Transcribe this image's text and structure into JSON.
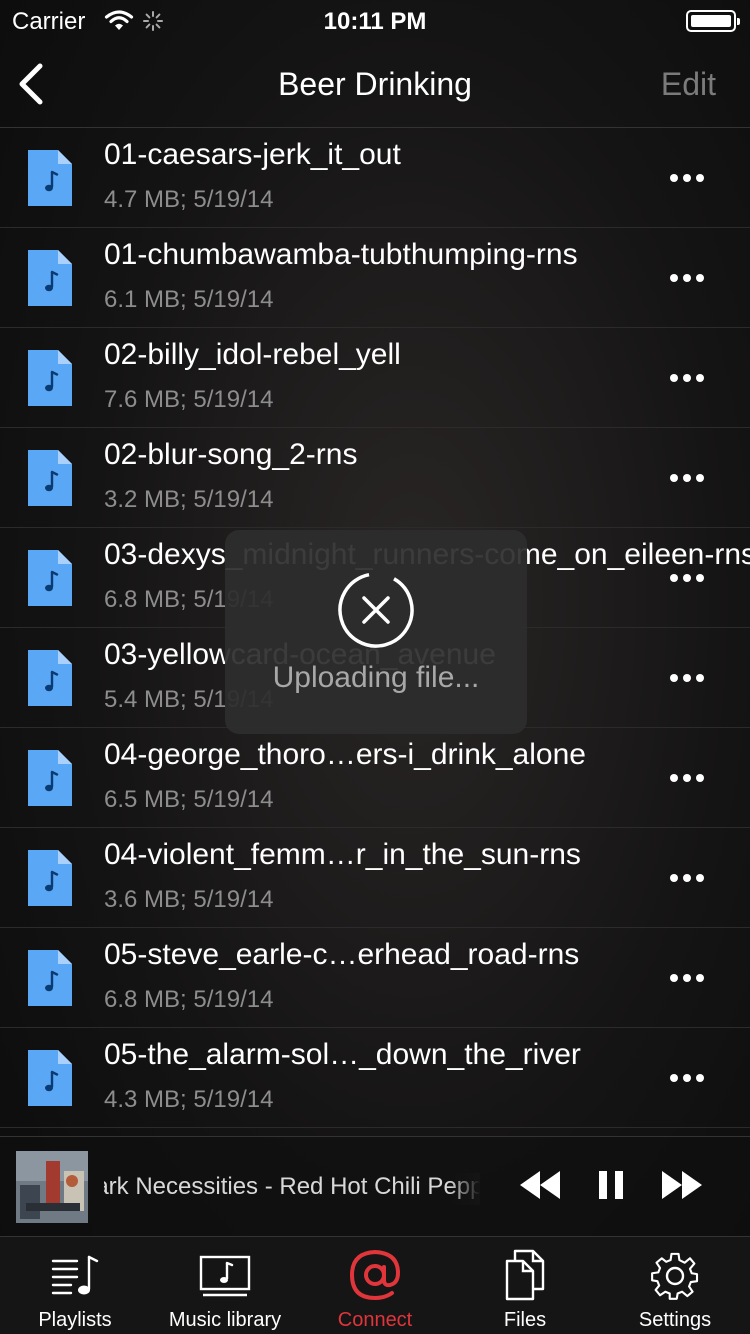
{
  "status_bar": {
    "carrier": "Carrier",
    "time": "10:11 PM"
  },
  "nav": {
    "title": "Beer Drinking",
    "edit_label": "Edit"
  },
  "files": [
    {
      "name": "01-caesars-jerk_it_out",
      "meta": "4.7 MB; 5/19/14"
    },
    {
      "name": "01-chumbawamba-tubthumping-rns",
      "meta": "6.1 MB; 5/19/14"
    },
    {
      "name": "02-billy_idol-rebel_yell",
      "meta": "7.6 MB; 5/19/14"
    },
    {
      "name": "02-blur-song_2-rns",
      "meta": "3.2 MB; 5/19/14"
    },
    {
      "name": "03-dexys_midnight_runners-come_on_eileen-rns",
      "meta": "6.8 MB; 5/19/14"
    },
    {
      "name": "03-yellowcard-ocean_avenue",
      "meta": "5.4 MB; 5/19/14"
    },
    {
      "name": "04-george_thoro…ers-i_drink_alone",
      "meta": "6.5 MB; 5/19/14"
    },
    {
      "name": "04-violent_femm…r_in_the_sun-rns",
      "meta": "3.6 MB; 5/19/14"
    },
    {
      "name": "05-steve_earle-c…erhead_road-rns",
      "meta": "6.8 MB; 5/19/14"
    },
    {
      "name": "05-the_alarm-sol…_down_the_river",
      "meta": "4.3 MB; 5/19/14"
    }
  ],
  "hud": {
    "text": "Uploading file...",
    "icon": "close-circle-icon"
  },
  "player": {
    "track": "Dark Necessities - Red Hot Chili Peppers"
  },
  "tabs": [
    {
      "label": "Playlists",
      "icon": "playlist-icon"
    },
    {
      "label": "Music library",
      "icon": "music-library-icon"
    },
    {
      "label": "Connect",
      "icon": "at-sign-icon",
      "active": true
    },
    {
      "label": "Files",
      "icon": "files-icon"
    },
    {
      "label": "Settings",
      "icon": "gear-icon"
    }
  ],
  "colors": {
    "accent": "#e0353b",
    "file_icon": "#5aa7f5",
    "muted": "#8d8d8d"
  }
}
